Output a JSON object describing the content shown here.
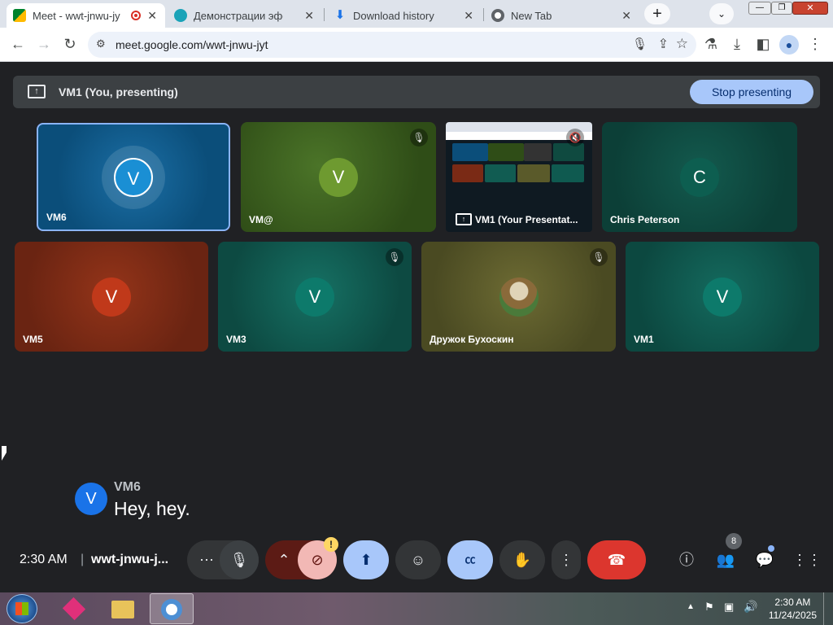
{
  "browser": {
    "tabs": [
      {
        "title": "Meet - wwt-jnwu-jy",
        "favicon": "meet-icon",
        "active": true,
        "recording": true
      },
      {
        "title": "Демонстрации эффект",
        "favicon": "cloud-icon",
        "active": false
      },
      {
        "title": "Download history",
        "favicon": "download-icon",
        "active": false
      },
      {
        "title": "New Tab",
        "favicon": "chrome-icon",
        "active": false
      }
    ],
    "new_tab": "+",
    "url": "meet.google.com/wwt-jnwu-jyt"
  },
  "presenting": {
    "label": "VM1 (You, presenting)",
    "stop_button": "Stop presenting"
  },
  "tiles": [
    {
      "name": "VM6",
      "initial": "V",
      "bg": "#0b4e7a",
      "avatar_color": "#1a8fd4",
      "speaking": true,
      "muted": false
    },
    {
      "name": "VM@",
      "initial": "V",
      "bg": "#3b5a1e",
      "avatar_color": "#5c8c2c",
      "muted": true
    },
    {
      "name": "VM1 (Your Presentat...",
      "initial": "",
      "bg": "#0f1a22",
      "screen_share": true,
      "muted": true
    },
    {
      "name": "Chris Peterson",
      "initial": "C",
      "bg": "#0f4a40",
      "avatar_color": "#0d5e50",
      "muted": false
    },
    {
      "name": "VM5",
      "initial": "V",
      "bg": "#7a2a15",
      "avatar_color": "#c0391a",
      "muted": false
    },
    {
      "name": "VM3",
      "initial": "V",
      "bg": "#115c52",
      "avatar_color": "#0d7a6b",
      "muted": true
    },
    {
      "name": "Дружок Бухоскин",
      "initial": "",
      "bg": "#5a5a2a",
      "photo": true,
      "muted": true
    },
    {
      "name": "VM1",
      "initial": "V",
      "bg": "#0f5a50",
      "avatar_color": "#0d7a6b",
      "muted": false
    }
  ],
  "caption": {
    "speaker": "VM6",
    "initial": "V",
    "text": "Hey, hey."
  },
  "meeting": {
    "time": "2:30 AM",
    "divider": "|",
    "code": "wwt-jnwu-j..."
  },
  "controls": {
    "more_options": "⋯",
    "people_count": "8",
    "camera_warning": "!"
  },
  "taskbar": {
    "time": "2:30 AM",
    "date": "11/24/2025"
  }
}
